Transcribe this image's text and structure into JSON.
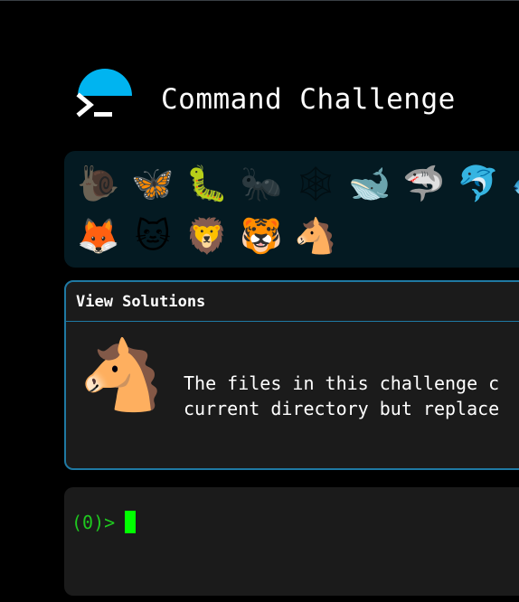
{
  "header": {
    "title": "Command Challenge",
    "colors": {
      "dome": "#00b4f0",
      "glyph": "#ffffff"
    }
  },
  "animals": {
    "row1": [
      {
        "name": "snail",
        "glyph": "🐌",
        "completed": false
      },
      {
        "name": "butterfly",
        "glyph": "🦋",
        "completed": true
      },
      {
        "name": "bug",
        "glyph": "🐛",
        "completed": true
      },
      {
        "name": "ant",
        "glyph": "🐜",
        "completed": false
      },
      {
        "name": "spider-web",
        "glyph": "🕸",
        "completed": false
      },
      {
        "name": "whale",
        "glyph": "🐋",
        "completed": true
      },
      {
        "name": "shark",
        "glyph": "🦈",
        "completed": true
      },
      {
        "name": "dolphin",
        "glyph": "🐬",
        "completed": true
      },
      {
        "name": "fish",
        "glyph": "🐟",
        "completed": true
      }
    ],
    "row2": [
      {
        "name": "fox",
        "glyph": "🦊",
        "completed": true
      },
      {
        "name": "cat",
        "glyph": "🐱",
        "completed": true
      },
      {
        "name": "lion",
        "glyph": "🦁",
        "completed": true
      },
      {
        "name": "tiger",
        "glyph": "🐯",
        "completed": true
      },
      {
        "name": "horse",
        "glyph": "🐴",
        "completed": true
      }
    ]
  },
  "solutions": {
    "label": "View Solutions",
    "icon": "horse-icon",
    "icon_glyph": "🐴",
    "text": "The files in this challenge c\ncurrent directory but replace"
  },
  "terminal": {
    "prompt": "(0)>",
    "input": ""
  }
}
